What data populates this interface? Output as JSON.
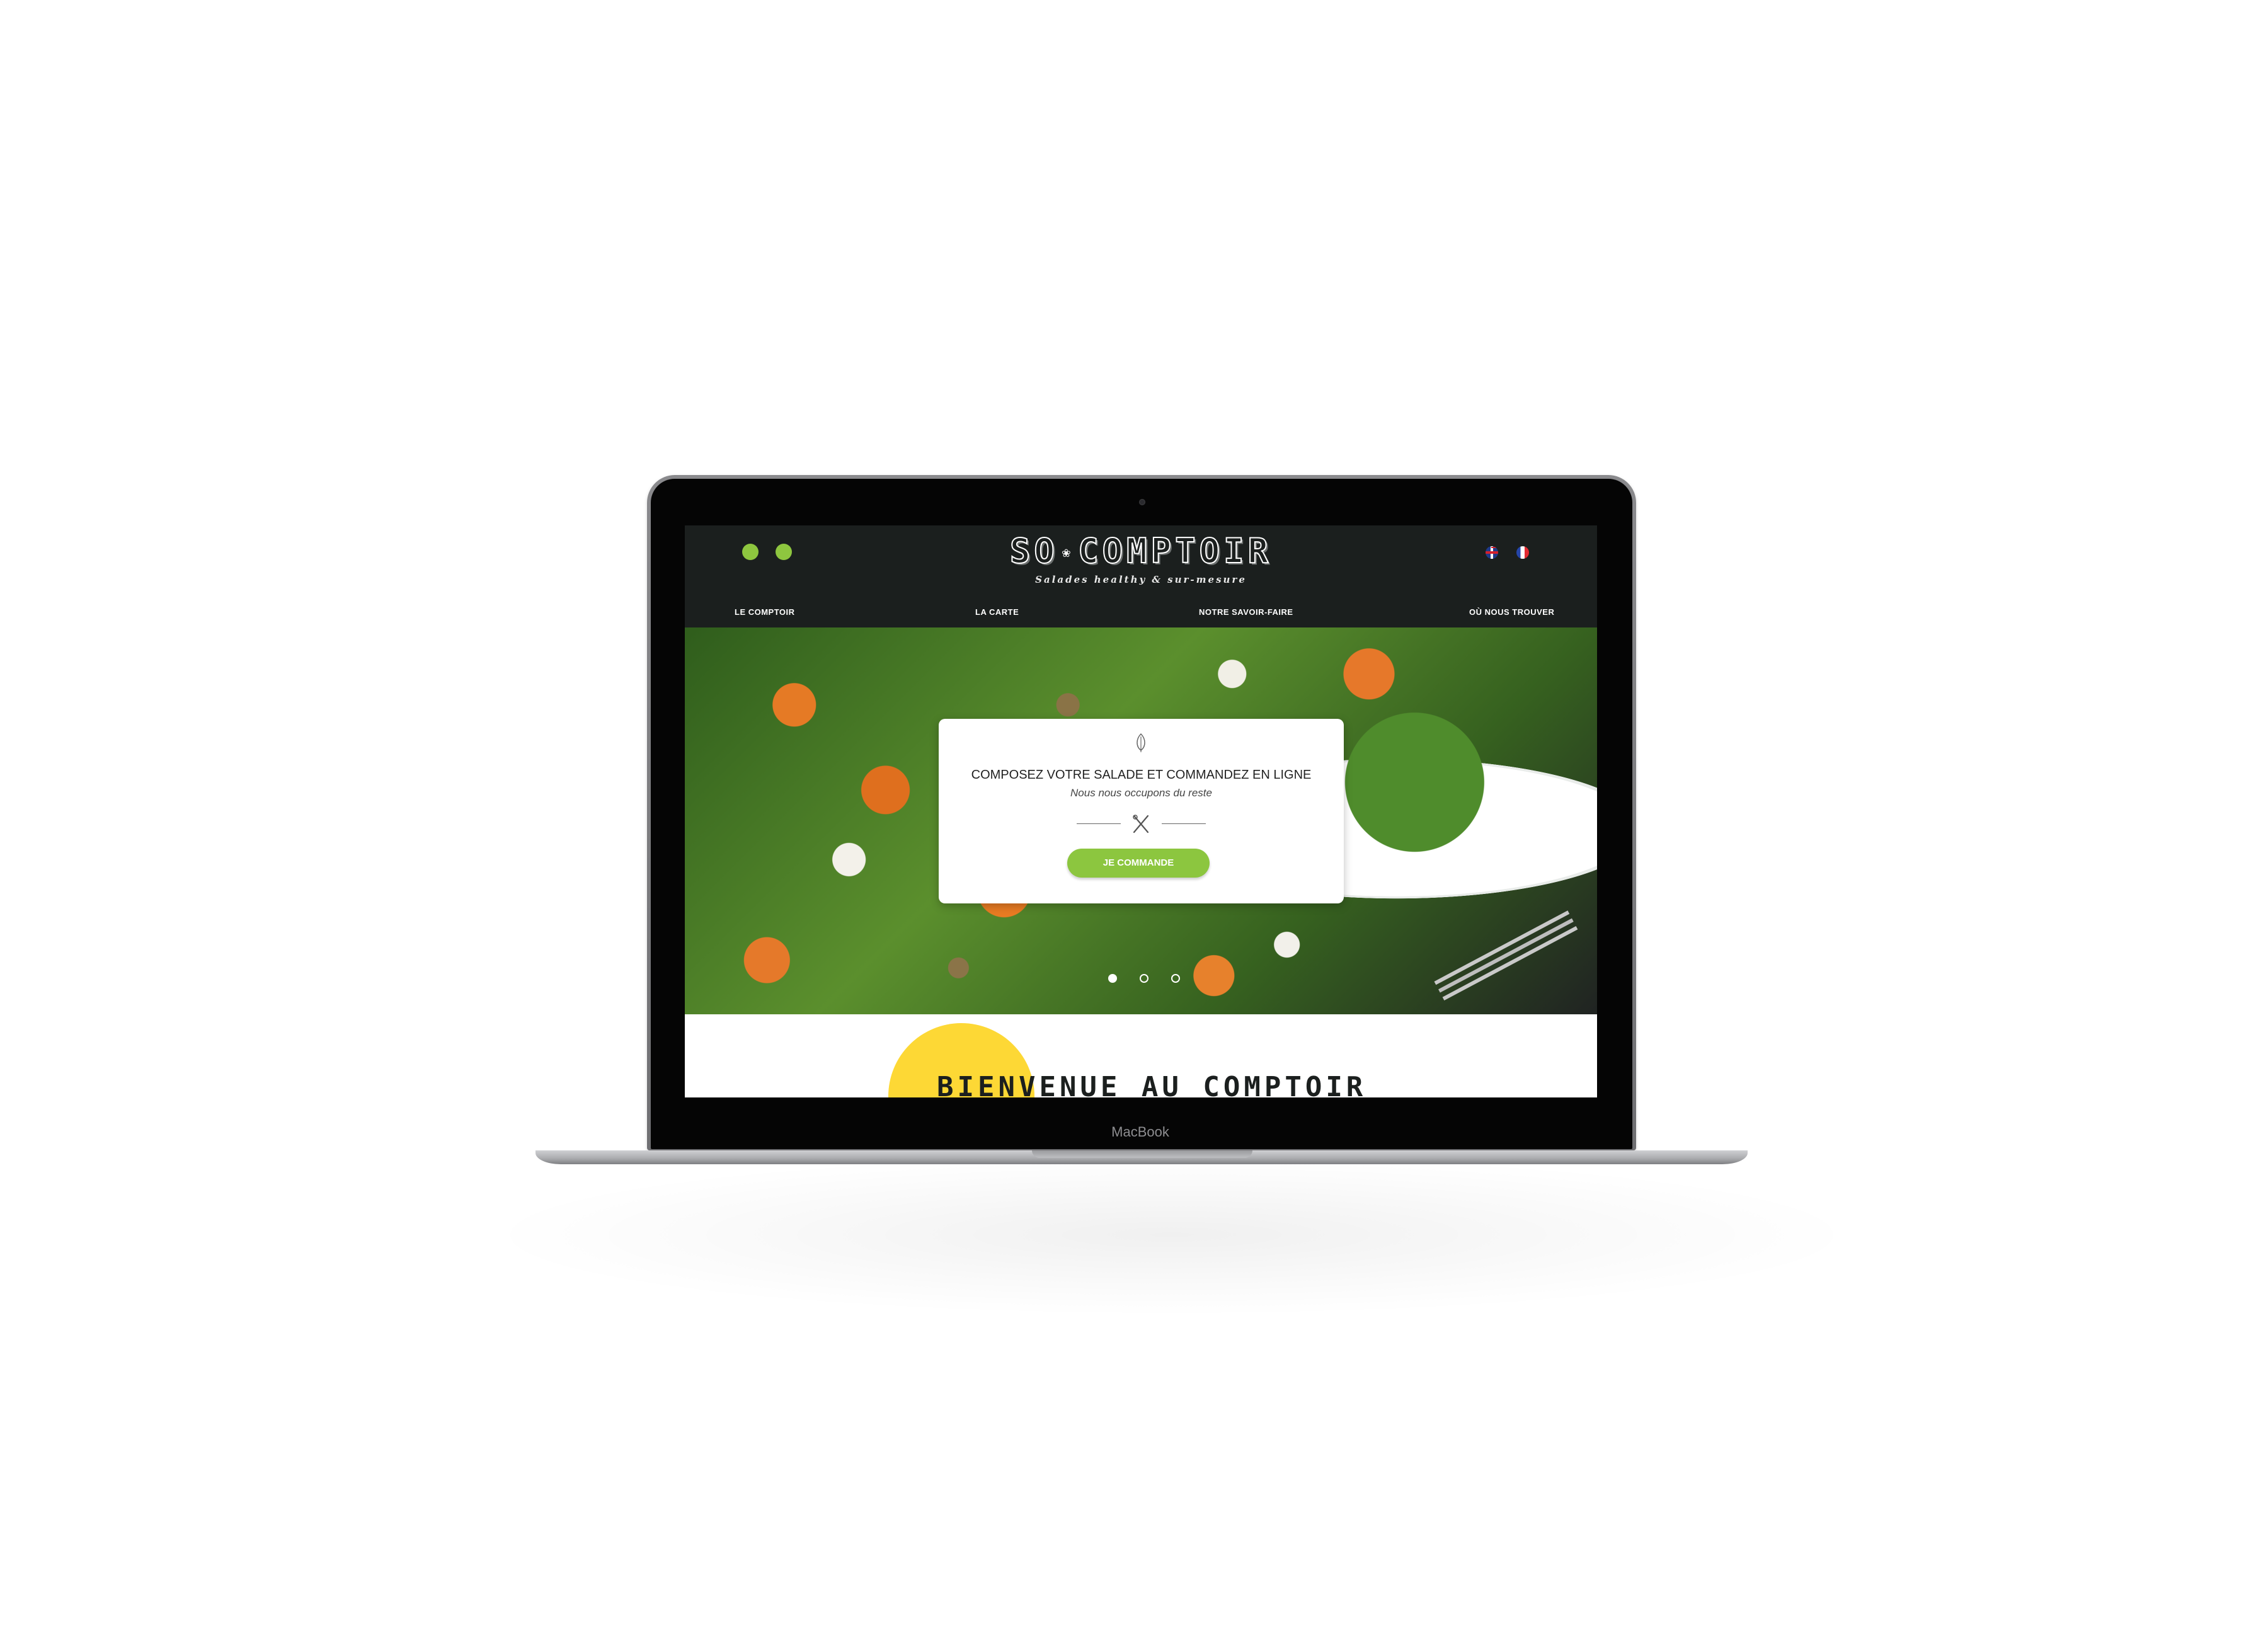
{
  "device": {
    "label": "MacBook"
  },
  "site": {
    "logo": {
      "left": "SO",
      "right": "COMPTOIR",
      "tagline": "Salades healthy & sur-mesure"
    },
    "languages": [
      "EN",
      "FR"
    ],
    "nav": [
      "LE COMPTOIR",
      "LA CARTE",
      "NOTRE SAVOIR-FAIRE",
      "OÙ NOUS TROUVER"
    ],
    "colors": {
      "header_bg": "#1b1f1e",
      "accent_green": "#8cc63f",
      "accent_yellow": "#fdd835"
    }
  },
  "hero": {
    "card": {
      "title": "COMPOSEZ VOTRE SALADE ET COMMANDEZ EN LIGNE",
      "subtitle": "Nous nous occupons du reste",
      "button": "JE COMMANDE"
    },
    "slides": {
      "count": 3,
      "active": 1
    }
  },
  "welcome": {
    "title": "BIENVENUE AU COMPTOIR"
  }
}
